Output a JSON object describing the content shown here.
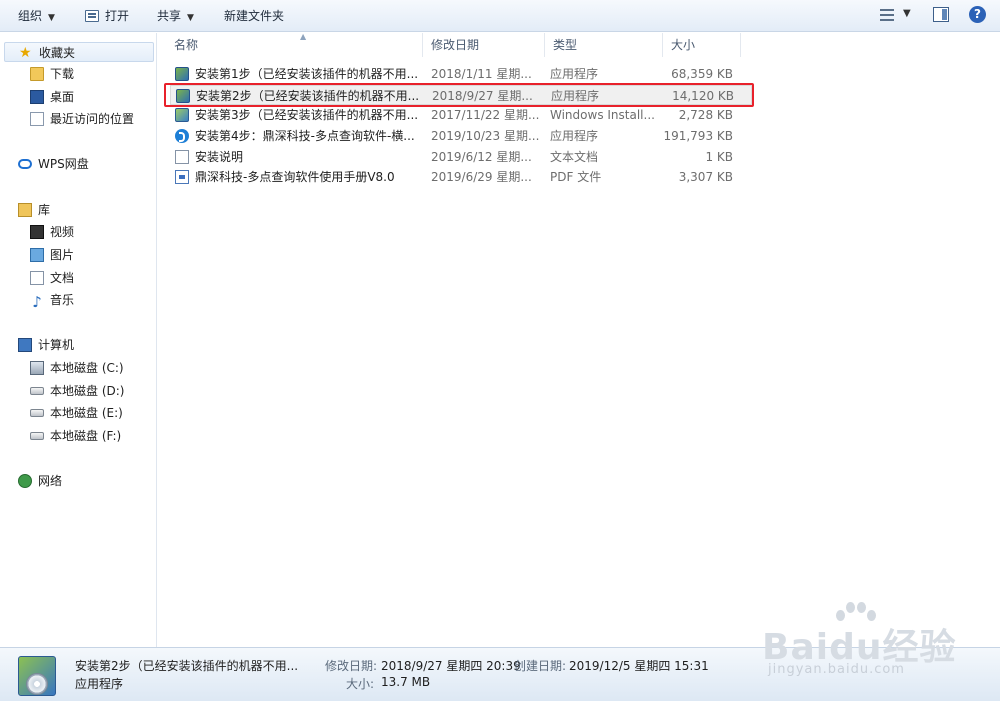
{
  "toolbar": {
    "organize": "组织",
    "open": "打开",
    "share": "共享",
    "new_folder": "新建文件夹"
  },
  "sidebar": {
    "favorites": "收藏夹",
    "downloads": "下载",
    "desktop": "桌面",
    "recent": "最近访问的位置",
    "wps": "WPS网盘",
    "library": "库",
    "videos": "视频",
    "pictures": "图片",
    "documents": "文档",
    "music": "音乐",
    "computer": "计算机",
    "drive_c": "本地磁盘 (C:)",
    "drive_d": "本地磁盘 (D:)",
    "drive_e": "本地磁盘 (E:)",
    "drive_f": "本地磁盘 (F:)",
    "network": "网络"
  },
  "columns": {
    "name": "名称",
    "modified": "修改日期",
    "type": "类型",
    "size": "大小"
  },
  "files": [
    {
      "name": "安装第1步（已经安装该插件的机器不用...",
      "date": "2018/1/11 星期...",
      "type": "应用程序",
      "size": "68,359 KB",
      "icon": "exe-icon"
    },
    {
      "name": "安装第2步（已经安装该插件的机器不用...",
      "date": "2018/9/27 星期...",
      "type": "应用程序",
      "size": "14,120 KB",
      "icon": "exe-icon"
    },
    {
      "name": "安装第3步（已经安装该插件的机器不用...",
      "date": "2017/11/22 星期...",
      "type": "Windows Install...",
      "size": "2,728 KB",
      "icon": "msi-icon"
    },
    {
      "name": "安装第4步：鼎深科技-多点查询软件-横...",
      "date": "2019/10/23 星期...",
      "type": "应用程序",
      "size": "191,793 KB",
      "icon": "dingshen-icon"
    },
    {
      "name": "安装说明",
      "date": "2019/6/12 星期...",
      "type": "文本文档",
      "size": "1 KB",
      "icon": "text-file-icon"
    },
    {
      "name": "鼎深科技-多点查询软件使用手册V8.0",
      "date": "2019/6/29 星期...",
      "type": "PDF 文件",
      "size": "3,307 KB",
      "icon": "pdf-file-icon"
    }
  ],
  "details": {
    "name": "安装第2步（已经安装该插件的机器不用...",
    "type": "应用程序",
    "modified_label": "修改日期:",
    "modified": "2018/9/27 星期四 20:39",
    "created_label": "创建日期:",
    "created": "2019/12/5 星期四 15:31",
    "size_label": "大小:",
    "size": "13.7 MB"
  },
  "watermark": {
    "brand": "Baidu经验",
    "url": "jingyan.baidu.com"
  },
  "colors": {
    "highlight": "#e8212b",
    "selection": "#f0f0f0",
    "toolbar": "#e3ecf7"
  }
}
